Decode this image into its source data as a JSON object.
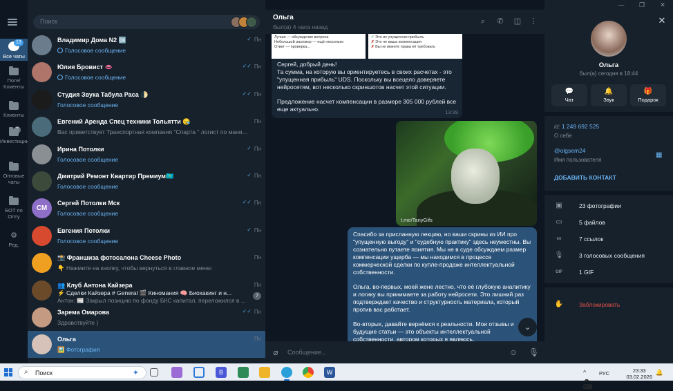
{
  "window": {
    "minimize": "—",
    "maximize": "❐",
    "close": "✕"
  },
  "folders": [
    {
      "label": "Все чаты",
      "badge": "13",
      "active": true
    },
    {
      "label": "Поте/Клиенты"
    },
    {
      "label": "Клиенты"
    },
    {
      "label": "Инвестиции",
      "badge": "3"
    },
    {
      "label": "Оптовые чаты"
    },
    {
      "label": "БОТ по Опту"
    },
    {
      "label": "Ред."
    }
  ],
  "search": {
    "placeholder": "Поиск"
  },
  "chats": [
    {
      "name": "Владимир Дома N2 🆗",
      "message": "Голосовое сообщение",
      "time": "Пн",
      "ticks": "✓",
      "voice": true,
      "avatar_color": "#6b7d8c",
      "initials": ""
    },
    {
      "name": "Юлия Бровист 👄",
      "message": "Голосовое сообщение",
      "time": "Пн",
      "ticks": "✓✓",
      "voice": true,
      "avatar_color": "#b0756a",
      "initials": ""
    },
    {
      "name": "Студия Звука Табула Раса 🌓",
      "message": "Голосовое сообщение",
      "time": "Пн",
      "ticks": "✓✓",
      "voice": false,
      "avatar_color": "#1b1b1b",
      "initials": ""
    },
    {
      "name": "Евгений Аренда Спец техники Тольятти 😪",
      "message": "Вас приветствует Транспортная компания       \"Спарта \" логист по мани...",
      "time": "Пн",
      "ticks": "",
      "voice": false,
      "grey": true,
      "avatar_color": "#4a6b7a",
      "initials": ""
    },
    {
      "name": "Ирина Потолки",
      "message": "Голосовое сообщение",
      "time": "Пн",
      "ticks": "✓",
      "voice": false,
      "avatar_color": "#8a8f94",
      "initials": ""
    },
    {
      "name": "Дмитрий Ремонт Квартир Премиум🇰🇿",
      "message": "Голосовое сообщение",
      "time": "Пн",
      "ticks": "✓",
      "voice": false,
      "avatar_color": "#3b4a3a",
      "initials": ""
    },
    {
      "name": "Сергей Потолки Мск",
      "message": "Голосовое сообщение",
      "time": "Пн",
      "ticks": "✓✓",
      "voice": false,
      "avatar_color": "#8e6fc7",
      "initials": "СМ"
    },
    {
      "name": "Евгения Потолки",
      "message": "Голосовое сообщение",
      "time": "Пн",
      "ticks": "✓",
      "voice": false,
      "avatar_color": "#d84a2f",
      "initials": ""
    },
    {
      "name": "📸 Франшиза фотосалона Cheese Photo",
      "message": "👇 Нажмите на кнопку, чтобы вернуться в главное меню",
      "time": "Пн",
      "ticks": "",
      "voice": false,
      "grey": true,
      "avatar_color": "#f0a020",
      "initials": ""
    },
    {
      "name": "👥 Клуб Антона Кайзера",
      "message": "⚡ Сделки Кайзера   # General   🎬 Киномания   🧠 Биохакинг и н...",
      "message2": "Антон: 📰 Закрыл позицию по фонду БКС капитал, переложился в ...",
      "time": "Пн",
      "ticks": "",
      "badge": "7",
      "avatar_color": "#6b4a2a",
      "initials": ""
    },
    {
      "name": "Зарема Омарова",
      "message": "Здравствуйте )",
      "time": "Пн",
      "ticks": "✓✓",
      "voice": false,
      "grey": true,
      "avatar_color": "#c49a82",
      "initials": ""
    },
    {
      "name": "Ольга",
      "message": "🖼️ Фотография",
      "time": "Пн",
      "ticks": "",
      "voice": false,
      "selected": true,
      "avatar_color": "#d6c2b8",
      "initials": ""
    }
  ],
  "conversation": {
    "name": "Ольга",
    "status": "был(а) 4 часа назад",
    "screenshot_left": [
      "Лучше — обсуждение вопроса",
      "Небольшой разговор — ещё несколько",
      "Ответ — проверка..."
    ],
    "screenshot_right": [
      {
        "mark": "✓",
        "text": "Это их упущенная прибыль"
      },
      {
        "mark": "✗",
        "text": "Это не ваша компенсация"
      },
      {
        "mark": "✗",
        "text": "Вы не имеете права её требовать"
      }
    ],
    "incoming": {
      "paragraphs": [
        "Сергей, добрый день!\nТа сумма, на которую вы ориентируетесь в своих расчетах - это \"упущенная прибыль\" UDS. Поскольку вы всецело доверяете нейросетям, вот несколько скриншотов насчет этой ситуации.",
        "Предложение насчет компенсации в размере 305 000 рублей все еще актуально."
      ],
      "time": "13:39"
    },
    "gif_caption": "t.me/TanyGifs",
    "outgoing": {
      "paragraphs": [
        "Спасибо за присланную лекцию, но ваши скрины из ИИ про \"упущенную выгоду\" и \"судебную практику\" здесь неуместны. Вы сознательно путаете понятия. Мы не в суде обсуждаем размер компенсации ущерба — мы находимся в процессе коммерческой сделки по купле-продаже интеллектуальной собственности.",
        "Ольга, во-первых, моей жене лестно, что её глубокую аналитику и логику вы принимаете за работу нейросети. Это лишний раз подтверждает качество и структурность материала, который против вас работает.",
        "Во-вторых, давайте вернёмся к реальности. Мои отзывы и будущие статьи — это объекты интеллектуальной собственности, автором которых я являюсь."
      ]
    },
    "composer_placeholder": "Сообщение..."
  },
  "profile": {
    "name": "Ольга",
    "status": "был(а) сегодня в 18:44",
    "actions": [
      {
        "icon": "chat-icon",
        "glyph": "💬",
        "label": "Чат"
      },
      {
        "icon": "bell-icon",
        "glyph": "🔔",
        "label": "Звук"
      },
      {
        "icon": "gift-icon",
        "glyph": "🎁",
        "label": "Подарок"
      }
    ],
    "id_label": "id:",
    "id_value": "1 249 692 525",
    "about_label": "О себе",
    "username": "@olgsem24",
    "username_label": "Имя пользователя",
    "add_contact": "ДОБАВИТЬ КОНТАКТ",
    "media": [
      {
        "icon": "photo-icon",
        "glyph": "▣",
        "label": "23 фотографии"
      },
      {
        "icon": "file-icon",
        "glyph": "▭",
        "label": "5 файлов"
      },
      {
        "icon": "link-icon",
        "glyph": "∞",
        "label": "7 ссылок"
      },
      {
        "icon": "mic-icon",
        "glyph": "🎙",
        "label": "3 голосовых сообщения"
      },
      {
        "icon": "gif-icon",
        "glyph": "GIF",
        "label": "1 GIF"
      }
    ],
    "block": "Заблокировать"
  },
  "taskbar": {
    "search_label": "Поиск",
    "lang": "РУС",
    "time": "23:33",
    "date": "03.02.2026",
    "tray_icons": "^ ☁ ⌨"
  }
}
